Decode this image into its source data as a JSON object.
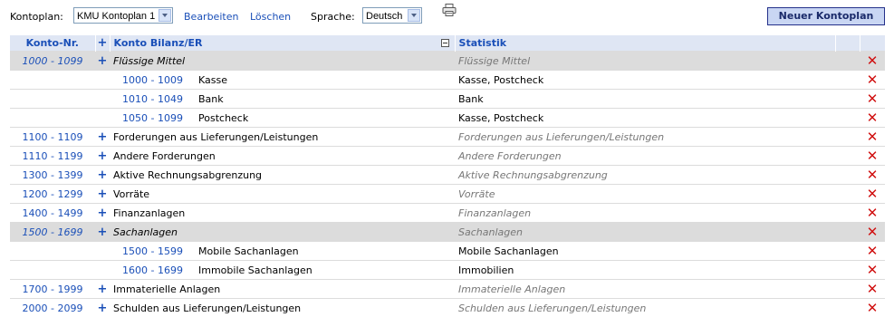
{
  "toolbar": {
    "kontoplan_label": "Kontoplan:",
    "kontoplan_value": "KMU Kontoplan 1",
    "edit_link": "Bearbeiten",
    "delete_link": "Löschen",
    "language_label": "Sprache:",
    "language_value": "Deutsch",
    "new_button": "Neuer Kontoplan"
  },
  "table": {
    "headers": {
      "konto_nr": "Konto-Nr.",
      "plus": "+",
      "konto_bilanz": "Konto Bilanz/ER",
      "statistik": "Statistik"
    },
    "rows": [
      {
        "type": "group",
        "range": "1000 - 1099",
        "plus": "+",
        "name": "Flüssige Mittel",
        "stat": "Flüssige Mittel"
      },
      {
        "type": "sub",
        "range": "1000 - 1009",
        "name": "Kasse",
        "stat": "Kasse, Postcheck"
      },
      {
        "type": "sub",
        "range": "1010 - 1049",
        "name": "Bank",
        "stat": "Bank"
      },
      {
        "type": "sub",
        "range": "1050 - 1099",
        "name": "Postcheck",
        "stat": "Kasse, Postcheck"
      },
      {
        "type": "top",
        "range": "1100 - 1109",
        "plus": "+",
        "name": "Forderungen aus Lieferungen/Leistungen",
        "stat": "Forderungen aus Lieferungen/Leistungen"
      },
      {
        "type": "top",
        "range": "1110 - 1199",
        "plus": "+",
        "name": "Andere Forderungen",
        "stat": "Andere Forderungen"
      },
      {
        "type": "top",
        "range": "1300 - 1399",
        "plus": "+",
        "name": "Aktive Rechnungsabgrenzung",
        "stat": "Aktive Rechnungsabgrenzung"
      },
      {
        "type": "top",
        "range": "1200 - 1299",
        "plus": "+",
        "name": "Vorräte",
        "stat": "Vorräte"
      },
      {
        "type": "top",
        "range": "1400 - 1499",
        "plus": "+",
        "name": "Finanzanlagen",
        "stat": "Finanzanlagen"
      },
      {
        "type": "group",
        "range": "1500 - 1699",
        "plus": "+",
        "name": "Sachanlagen",
        "stat": "Sachanlagen"
      },
      {
        "type": "sub",
        "range": "1500 - 1599",
        "name": "Mobile Sachanlagen",
        "stat": "Mobile Sachanlagen"
      },
      {
        "type": "sub",
        "range": "1600 - 1699",
        "name": "Immobile Sachanlagen",
        "stat": "Immobilien"
      },
      {
        "type": "top",
        "range": "1700 - 1999",
        "plus": "+",
        "name": "Immaterielle Anlagen",
        "stat": "Immaterielle Anlagen"
      },
      {
        "type": "top",
        "range": "2000 - 2099",
        "plus": "+",
        "name": "Schulden aus Lieferungen/Leistungen",
        "stat": "Schulden aus Lieferungen/Leistungen"
      }
    ]
  },
  "colors": {
    "link": "#1a4fb8",
    "delete": "#d01010",
    "group_bg": "#dcdcdc",
    "header_bg": "#dfe6f4"
  },
  "icons": {
    "print": "printer-icon",
    "delete": "delete-x-icon",
    "expand": "plus-icon",
    "collapse": "collapse-minus-icon"
  }
}
